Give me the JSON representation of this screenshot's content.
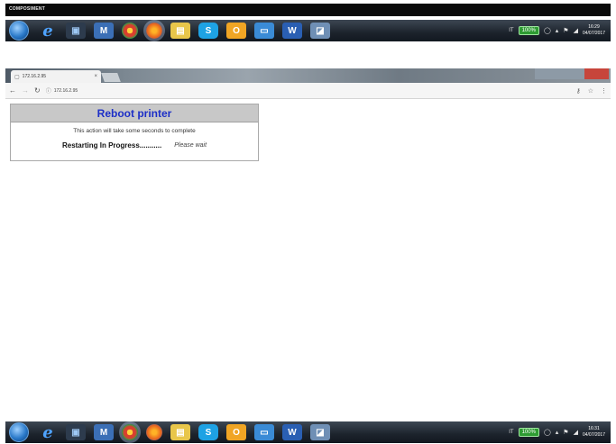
{
  "title_strip": {
    "text": "COMPOSIMENT"
  },
  "browser": {
    "tab_title": "172.16.2.95",
    "tab_close": "×",
    "url": "172.16.2.95"
  },
  "panel": {
    "title": "Reboot printer",
    "note": "This action will take some seconds to complete",
    "status": "Restarting In Progress...........",
    "wait": "Please wait"
  },
  "taskbar_top": {
    "lang": "IT",
    "battery": "100%",
    "time": "16:29",
    "date": "04/07/2017"
  },
  "taskbar_bottom": {
    "lang": "IT",
    "battery": "100%",
    "time": "16:31",
    "date": "04/07/2017"
  },
  "icons": {
    "ie": "e",
    "skype": "S",
    "word": "W",
    "outlook": "O",
    "mag": "M"
  },
  "colors": {
    "panel_title": "#1d2fc7",
    "panel_header_bg": "#c8c8c8",
    "taskbar": "#1c232c"
  }
}
